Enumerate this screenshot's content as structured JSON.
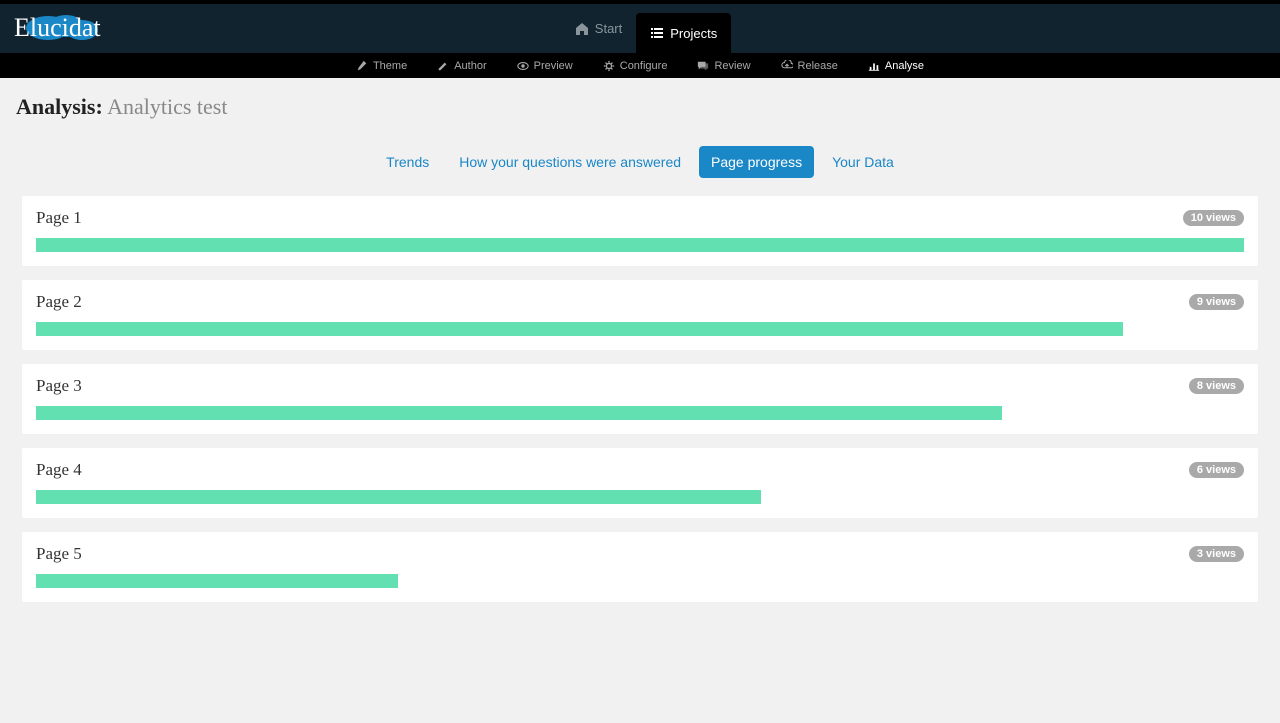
{
  "logo_text": "Elucidat",
  "topnav": [
    {
      "label": "Start",
      "icon": "home",
      "active": false
    },
    {
      "label": "Projects",
      "icon": "list",
      "active": true
    }
  ],
  "subnav": [
    {
      "label": "Theme",
      "icon": "brush",
      "active": false
    },
    {
      "label": "Author",
      "icon": "pencil",
      "active": false
    },
    {
      "label": "Preview",
      "icon": "eye",
      "active": false
    },
    {
      "label": "Configure",
      "icon": "cog",
      "active": false
    },
    {
      "label": "Review",
      "icon": "comments",
      "active": false
    },
    {
      "label": "Release",
      "icon": "cloud-up",
      "active": false
    },
    {
      "label": "Analyse",
      "icon": "bar-chart",
      "active": true
    }
  ],
  "page_title": {
    "prefix": "Analysis:",
    "name": "Analytics test"
  },
  "tabs": [
    {
      "label": "Trends",
      "active": false
    },
    {
      "label": "How your questions were answered",
      "active": false
    },
    {
      "label": "Page progress",
      "active": true
    },
    {
      "label": "Your Data",
      "active": false
    }
  ],
  "chart_data": {
    "type": "bar",
    "title": "Page progress",
    "xlabel": "views",
    "ylabel": "",
    "xlim": [
      0,
      10
    ],
    "categories": [
      "Page 1",
      "Page 2",
      "Page 3",
      "Page 4",
      "Page 5"
    ],
    "values": [
      10,
      9,
      8,
      6,
      3
    ],
    "value_labels": [
      "10 views",
      "9 views",
      "8 views",
      "6 views",
      "3 views"
    ],
    "bar_color": "#62e0b2"
  }
}
